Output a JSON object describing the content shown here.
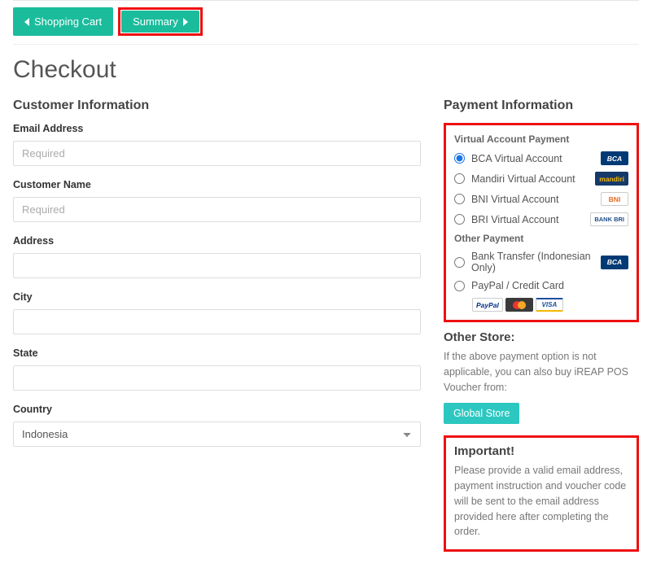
{
  "nav": {
    "cart": "Shopping Cart",
    "summary": "Summary"
  },
  "title": "Checkout",
  "customer": {
    "heading": "Customer Information",
    "email_label": "Email Address",
    "email_placeholder": "Required",
    "name_label": "Customer Name",
    "name_placeholder": "Required",
    "address_label": "Address",
    "city_label": "City",
    "state_label": "State",
    "country_label": "Country",
    "country_value": "Indonesia"
  },
  "payment": {
    "heading": "Payment Information",
    "va_heading": "Virtual Account Payment",
    "other_heading": "Other Payment",
    "options": {
      "bca": "BCA Virtual Account",
      "mandiri": "Mandiri Virtual Account",
      "bni": "BNI Virtual Account",
      "bri": "BRI Virtual Account",
      "bank": "Bank Transfer (Indonesian Only)",
      "paypal": "PayPal / Credit Card"
    },
    "badges": {
      "bca": "BCA",
      "mandiri": "mandiri",
      "bni": "BNI",
      "bri": "BANK BRI",
      "paypal": "PayPal",
      "visa": "VISA"
    }
  },
  "other_store": {
    "heading": "Other Store:",
    "text": "If the above payment option is not applicable, you can also buy iREAP POS Voucher from:",
    "button": "Global Store"
  },
  "important": {
    "heading": "Important!",
    "text": "Please provide a valid email address, payment instruction and voucher code will be sent to the email address provided here after completing the order."
  }
}
